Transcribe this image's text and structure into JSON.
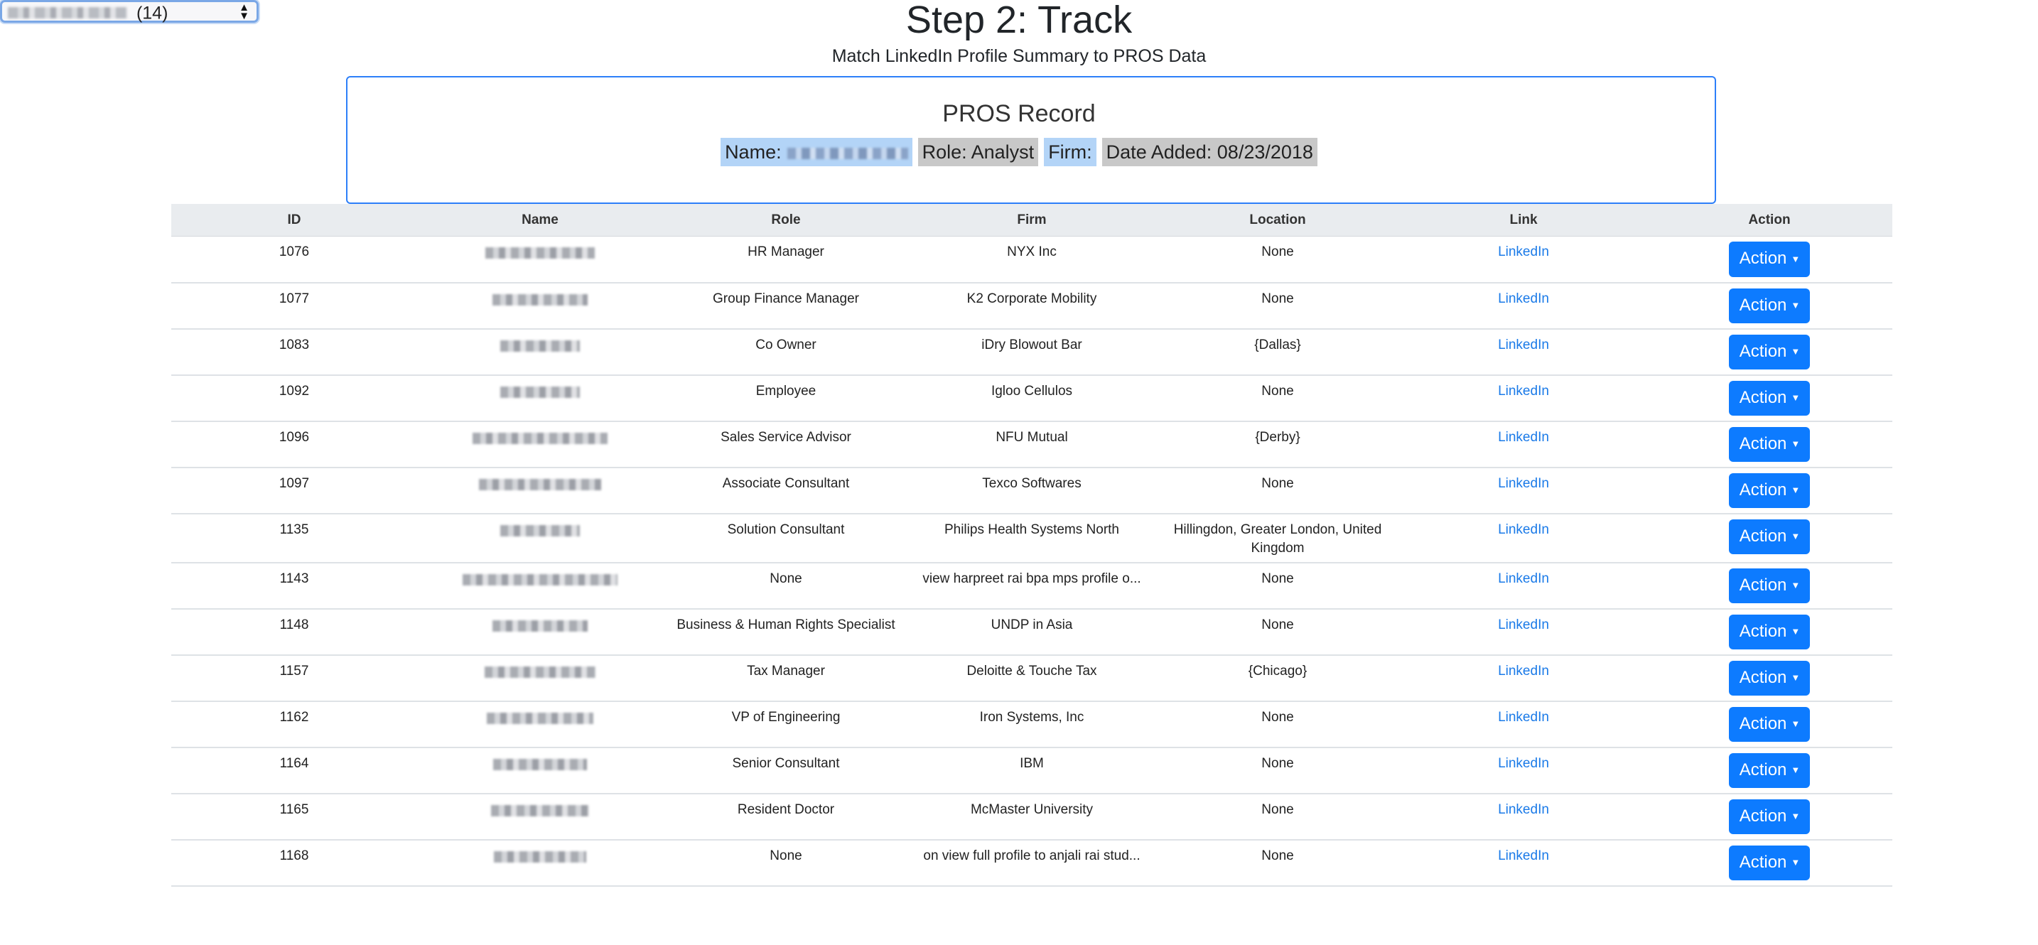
{
  "selector": {
    "count_label": "(14)"
  },
  "header": {
    "title": "Step 2: Track",
    "subtitle": "Match LinkedIn Profile Summary to PROS Data"
  },
  "pros_record": {
    "heading": "PROS Record",
    "name_label": "Name:",
    "role_label": "Role: Analyst",
    "firm_label": "Firm:",
    "date_label": "Date Added: 08/23/2018"
  },
  "table": {
    "headers": [
      "ID",
      "Name",
      "Role",
      "Firm",
      "Location",
      "Link",
      "Action"
    ],
    "link_label": "LinkedIn",
    "action_label": "Action",
    "rows": [
      {
        "id": "1076",
        "role": "HR Manager",
        "firm": "NYX Inc",
        "location": "None"
      },
      {
        "id": "1077",
        "role": "Group Finance Manager",
        "firm": "K2 Corporate Mobility",
        "location": "None"
      },
      {
        "id": "1083",
        "role": "Co Owner",
        "firm": "iDry Blowout Bar",
        "location": "{Dallas}"
      },
      {
        "id": "1092",
        "role": "Employee",
        "firm": "Igloo Cellulos",
        "location": "None"
      },
      {
        "id": "1096",
        "role": "Sales Service Advisor",
        "firm": "NFU Mutual",
        "location": "{Derby}"
      },
      {
        "id": "1097",
        "role": "Associate Consultant",
        "firm": "Texco Softwares",
        "location": "None"
      },
      {
        "id": "1135",
        "role": "Solution Consultant",
        "firm": "Philips Health Systems North",
        "location": "Hillingdon, Greater London, United Kingdom"
      },
      {
        "id": "1143",
        "role": "None",
        "firm": "view harpreet rai bpa mps profile o...",
        "location": "None"
      },
      {
        "id": "1148",
        "role": "Business & Human Rights Specialist",
        "firm": "UNDP in Asia",
        "location": "None"
      },
      {
        "id": "1157",
        "role": "Tax Manager",
        "firm": "Deloitte & Touche Tax",
        "location": "{Chicago}"
      },
      {
        "id": "1162",
        "role": "VP of Engineering",
        "firm": "Iron Systems, Inc",
        "location": "None"
      },
      {
        "id": "1164",
        "role": "Senior Consultant",
        "firm": "IBM",
        "location": "None"
      },
      {
        "id": "1165",
        "role": "Resident Doctor",
        "firm": "McMaster University",
        "location": "None"
      },
      {
        "id": "1168",
        "role": "None",
        "firm": "on view full profile to anjali rai stud...",
        "location": "None"
      }
    ]
  }
}
